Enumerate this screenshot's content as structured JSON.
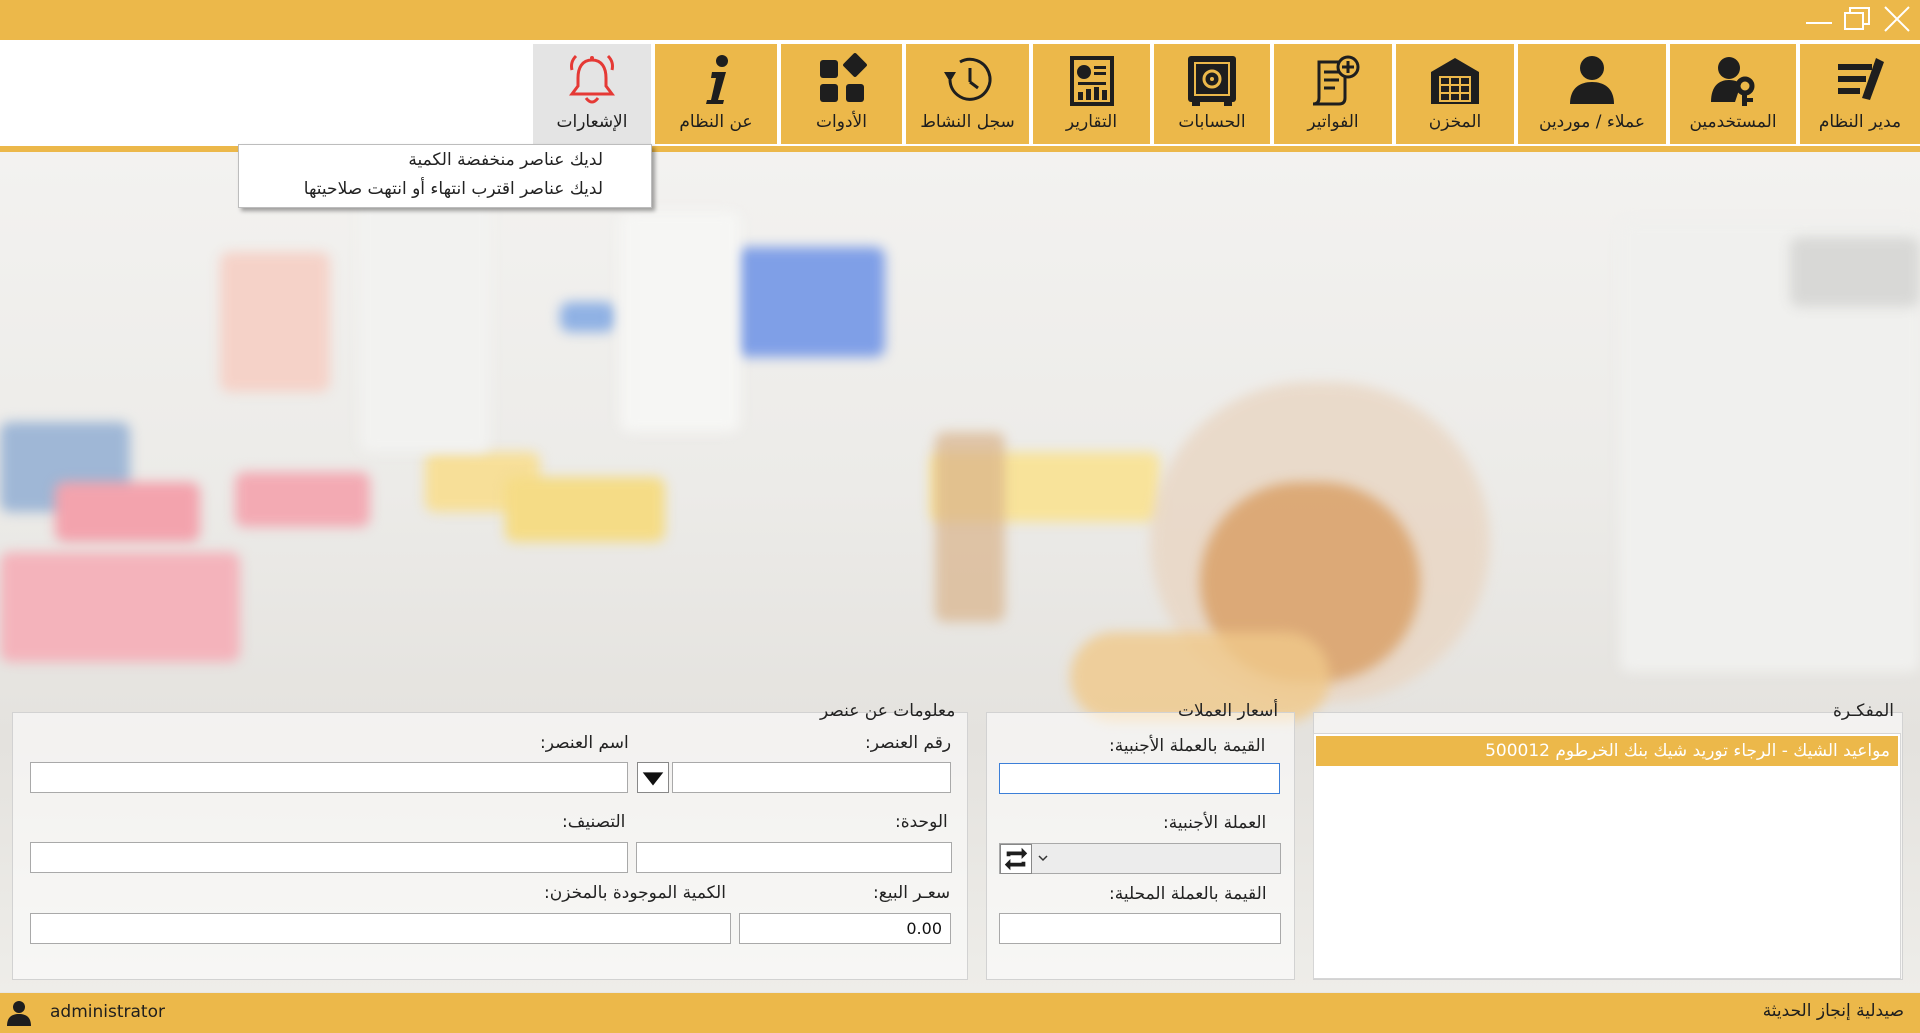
{
  "window": {
    "minimize_icon": "minimize-icon",
    "restore_icon": "restore-icon",
    "close_icon": "close-icon"
  },
  "colors": {
    "accent": "#ecb84a",
    "notification_bell": "#e53935",
    "active_border": "#3c7fd8"
  },
  "ribbon": {
    "buttons": [
      {
        "label": "مدير النظام",
        "icon": "system-manager-icon"
      },
      {
        "label": "المستخدمين",
        "icon": "users-key-icon"
      },
      {
        "label": "عملاء / موردين",
        "icon": "person-icon"
      },
      {
        "label": "المخزن",
        "icon": "warehouse-icon"
      },
      {
        "label": "الفواتير",
        "icon": "invoice-icon"
      },
      {
        "label": "الحسابات",
        "icon": "safe-icon"
      },
      {
        "label": "التقارير",
        "icon": "report-icon"
      },
      {
        "label": "سجل النشاط",
        "icon": "history-clock-icon"
      },
      {
        "label": "الأدوات",
        "icon": "tools-icon"
      },
      {
        "label": "عن النظام",
        "icon": "info-icon"
      },
      {
        "label": "الإشعارات",
        "icon": "bell-icon"
      }
    ]
  },
  "notifications": {
    "items": [
      "لديك عناصر منخفضة الكمية",
      "لديك عناصر اقترب انتهاء أو انتهت صلاحيتها"
    ]
  },
  "memo": {
    "title": "المفكـرة",
    "items": [
      "مواعيد الشيك - الرجاء توريد شيك بنك الخرطوم 500012"
    ]
  },
  "currency": {
    "title": "أسعار العملات",
    "foreign_value_label": "القيمة بالعملة الأجنبية:",
    "foreign_value": "",
    "foreign_currency_label": "العملة الأجنبية:",
    "foreign_currency_value": "",
    "swap_icon": "swap-icon",
    "dropdown_icon": "chevron-down-icon",
    "local_value_label": "القيمة بالعملة المحلية:",
    "local_value": ""
  },
  "item_info": {
    "title": "معلومات عن عنصر",
    "item_number_label": "رقم العنصر:",
    "item_number": "",
    "item_name_label": "اسم العنصر:",
    "item_name": "",
    "dropdown_icon": "triangle-down-icon",
    "unit_label": "الوحدة:",
    "unit": "",
    "category_label": "التصنيف:",
    "category": "",
    "sale_price_label": "سعـر البيع:",
    "sale_price": "0.00",
    "stock_qty_label": "الكمية الموجودة بالمخزن:",
    "stock_qty": ""
  },
  "status": {
    "user": "administrator",
    "user_icon": "user-icon",
    "pharmacy": "صيدلية إنجاز الحديثة"
  }
}
